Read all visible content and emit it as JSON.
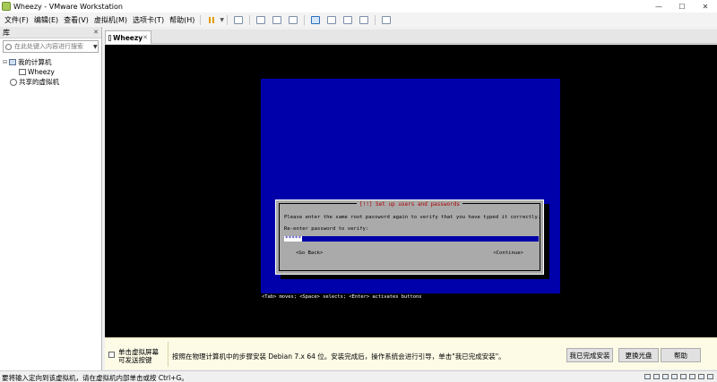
{
  "window": {
    "title": "Wheezy - VMware Workstation",
    "controls": {
      "minimize": "—",
      "maximize": "☐",
      "close": "✕"
    }
  },
  "menu": [
    "文件(F)",
    "编辑(E)",
    "查看(V)",
    "虚拟机(M)",
    "选项卡(T)",
    "帮助(H)"
  ],
  "library": {
    "header": "库",
    "close": "✕",
    "search_placeholder": "在此处键入内容进行搜索",
    "tree": {
      "root": "我的计算机",
      "vm": "Wheezy",
      "shared": "共享的虚拟机"
    }
  },
  "tab": {
    "label": "Wheezy",
    "close": "✕"
  },
  "installer": {
    "dialog_title": "[!!] Set up users and passwords",
    "prompt": "Please enter the same root password again to verify that you have typed it correctly.",
    "field_label": "Re-enter password to verify:",
    "password_mask": "*****",
    "back": "<Go Back>",
    "continue": "<Continue>",
    "status": "<Tab> moves; <Space> selects; <Enter> activates buttons"
  },
  "infobar": {
    "left_line1": "单击虚拟屏幕",
    "left_line2": "可发送按键",
    "message": "按照在物理计算机中的步骤安装 Debian 7.x 64 位。安装完成后，操作系统会进行引导，单击\"我已完成安装\"。",
    "buttons": [
      "我已完成安装",
      "更换光盘",
      "帮助"
    ]
  },
  "status_bar": "要将输入定向到该虚拟机，请在虚拟机内部单击或按 Ctrl+G。"
}
